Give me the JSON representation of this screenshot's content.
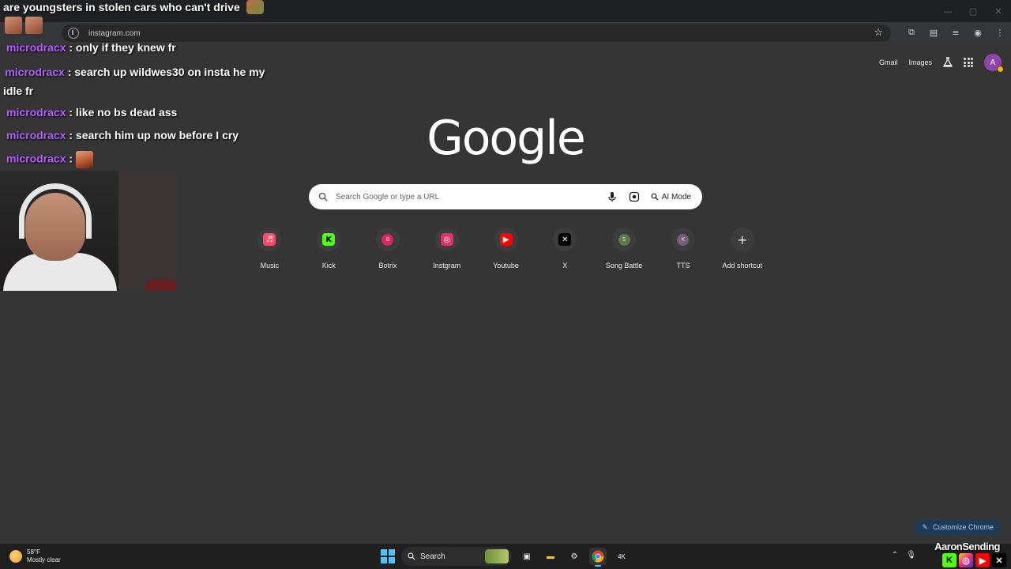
{
  "browser": {
    "url": "instagram.com",
    "window_controls": [
      "—",
      "▢",
      "✕"
    ]
  },
  "top_links": {
    "gmail": "Gmail",
    "images": "Images",
    "avatar_letter": "A"
  },
  "logo": "Google",
  "search": {
    "placeholder": "Search Google or type a URL",
    "ai_mode_label": "AI Mode"
  },
  "shortcuts": [
    {
      "label": "Music",
      "icon": "music-icon",
      "glyph": "♬",
      "color": "#fa4a6b"
    },
    {
      "label": "Kick",
      "icon": "kick-icon",
      "glyph": "K",
      "color": "#53fc18"
    },
    {
      "label": "Botrix",
      "icon": "botrix-icon",
      "glyph": "B",
      "color": "#e0245e"
    },
    {
      "label": "Instgram",
      "icon": "instagram-icon",
      "glyph": "◎",
      "color": "#e1306c"
    },
    {
      "label": "Youtube",
      "icon": "youtube-icon",
      "glyph": "▶",
      "color": "#ff0000"
    },
    {
      "label": "X",
      "icon": "x-icon",
      "glyph": "✕",
      "color": "#000000"
    },
    {
      "label": "Song Battle",
      "icon": "song-battle-icon",
      "glyph": "S",
      "color": "#5a7a4a"
    },
    {
      "label": "TTS",
      "icon": "tts-icon",
      "glyph": "K",
      "color": "#7a5a7a"
    },
    {
      "label": "Add shortcut",
      "icon": "plus-icon",
      "glyph": "+",
      "color": "#3c3c3c"
    }
  ],
  "customize": {
    "label": "Customize Chrome"
  },
  "stream": {
    "title": "are youngsters in stolen cars who can't drive",
    "chat": [
      {
        "user": "microdracx",
        "text": ": only if they knew fr"
      },
      {
        "user": "microdracx",
        "text": ": search up wildwes30 on insta he my idle fr"
      },
      {
        "user": "microdracx",
        "text": ": like no bs dead ass"
      },
      {
        "user": "microdracx",
        "text": ": search him up now before I cry"
      },
      {
        "user": "microdracx",
        "text": ":"
      }
    ],
    "brand": "AaronSending"
  },
  "taskbar": {
    "temperature": "58°F",
    "condition": "Mostly clear",
    "search_label": "Search"
  }
}
